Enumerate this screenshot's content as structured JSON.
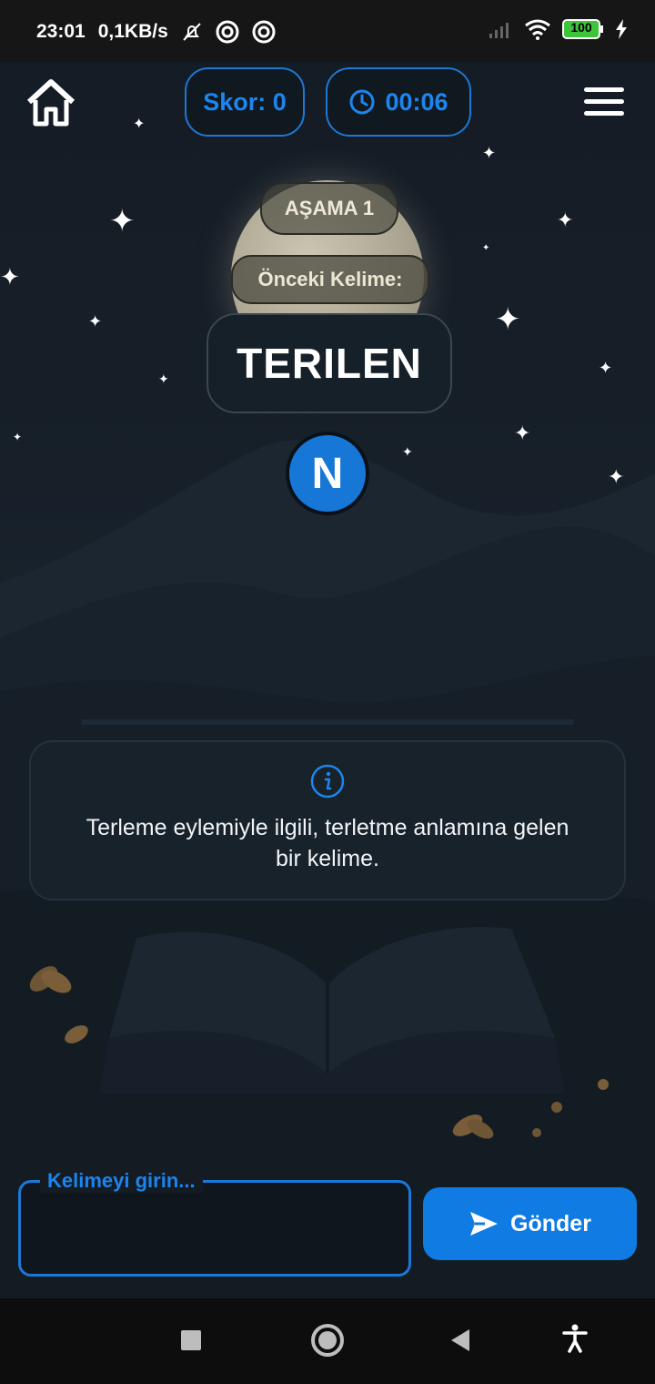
{
  "status_bar": {
    "time": "23:01",
    "network_speed": "0,1KB/s",
    "battery": "100",
    "icons": [
      "mute-bell-icon",
      "app-notification-icon",
      "app-notification-icon",
      "signal-icon",
      "wifi-icon",
      "battery-icon",
      "charging-icon"
    ]
  },
  "header": {
    "home_icon": "home-icon",
    "score_label": "Skor: 0",
    "timer_value": "00:06",
    "timer_icon": "clock-icon",
    "menu_icon": "hamburger-icon"
  },
  "game": {
    "stage_label": "AŞAMA 1",
    "previous_word_label": "Önceki Kelime:",
    "previous_word": "TERILEN",
    "next_letter": "N"
  },
  "hint": {
    "icon": "info-icon",
    "text_line1": "Terleme eylemiyle ilgili, terletme anlamına gelen",
    "text_line2": "bir kelime."
  },
  "input": {
    "label": "Kelimeyi girin...",
    "value": ""
  },
  "send_button": {
    "label": "Gönder",
    "icon": "send-icon"
  },
  "nav_bar": {
    "items": [
      "recents-icon",
      "home-circle-icon",
      "back-icon",
      "accessibility-icon"
    ]
  },
  "colors": {
    "accent": "#1677d6",
    "background": "#141b24",
    "card": "#18222c",
    "text": "#ffffff"
  }
}
